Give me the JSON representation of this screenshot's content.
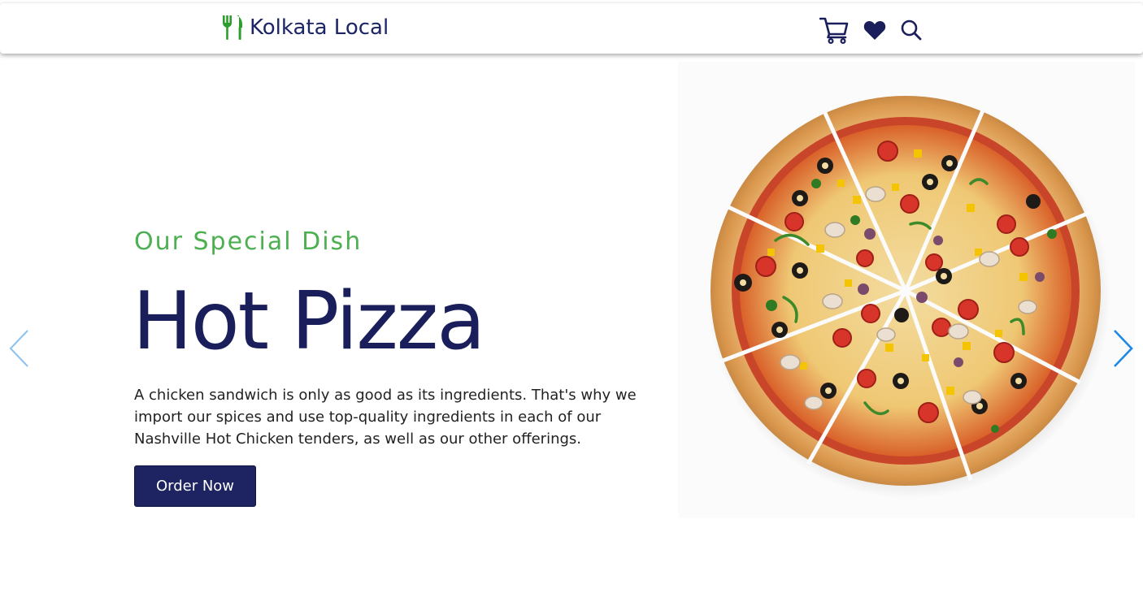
{
  "header": {
    "brand_name": "Kolkata Local",
    "brand_icon": "fork-knife-icon",
    "icons": [
      "cart-icon",
      "heart-icon",
      "search-icon"
    ]
  },
  "hero": {
    "subtitle": "Our Special Dish",
    "title": "Hot Pizza",
    "description": "A chicken sandwich is only as good as its ingredients. That's why we import our spices and use top-quality ingredients in each of our Nashville Hot Chicken tenders, as well as our other offerings.",
    "button_label": "Order Now",
    "image": "pizza-image",
    "prev_icon": "chevron-left-icon",
    "next_icon": "chevron-right-icon"
  },
  "colors": {
    "brand_navy": "#1a1f5c",
    "accent_green": "#4caf50",
    "button_bg": "#1e2461",
    "arrow_blue": "#1e88e5"
  }
}
